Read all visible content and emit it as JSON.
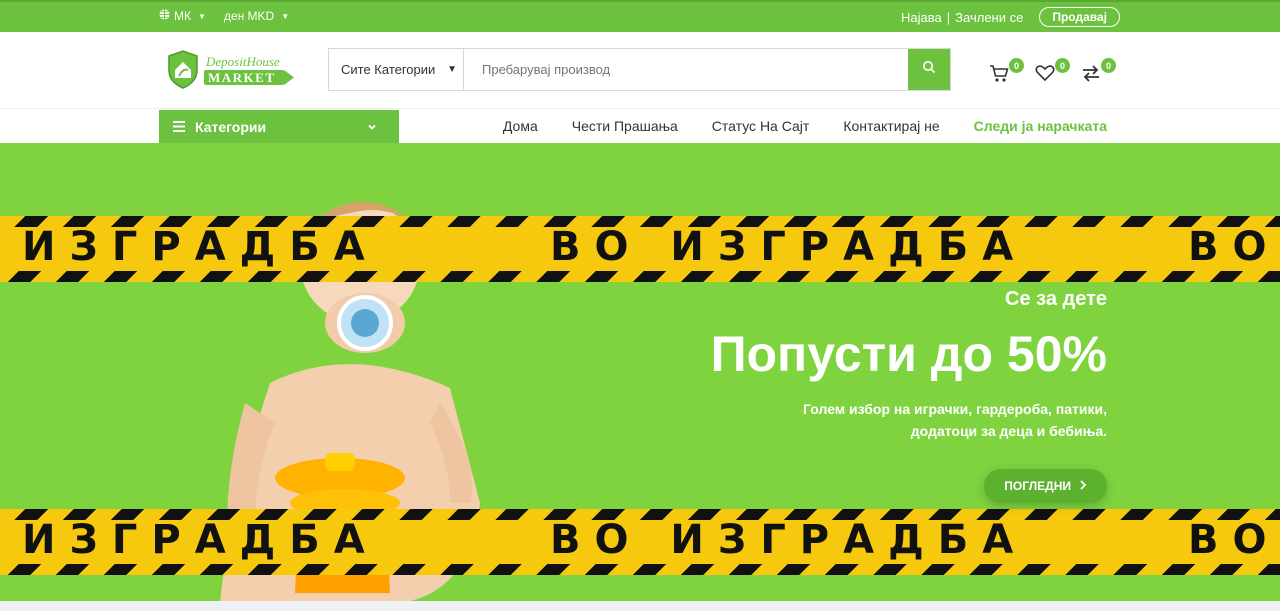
{
  "topbar": {
    "language": "МК",
    "currency": "ден MKD",
    "login": "Најава",
    "separator": "|",
    "register": "Зачлени се",
    "sell_button": "Продавај"
  },
  "header": {
    "logo_line1": "DepositHouse",
    "logo_line2": "MARKET",
    "search_category": "Сите Категории",
    "search_placeholder": "Пребарувај производ",
    "cart_count": "0",
    "wishlist_count": "0",
    "compare_count": "0"
  },
  "nav": {
    "categories_label": "Категории",
    "links": [
      "Дома",
      "Чести Прашања",
      "Статус На Сајт",
      "Контактирај не"
    ],
    "track_order": "Следи ја нарачката"
  },
  "hero": {
    "tape_text_1": "ИЗГРАДБА",
    "tape_text_2": "ВО ИЗГРАДБА",
    "tape_text_3": "ВО",
    "eyebrow": "Се за дете",
    "headline": "Попусти до 50%",
    "desc_line1": "Голем избор на играчки, гардероба, патики,",
    "desc_line2": "додатоци за деца и бебиња.",
    "cta": "ПОГЛЕДНИ"
  },
  "colors": {
    "brand_green": "#6cc13f",
    "hero_green": "#7ed33f",
    "tape_yellow": "#f6c90e"
  }
}
